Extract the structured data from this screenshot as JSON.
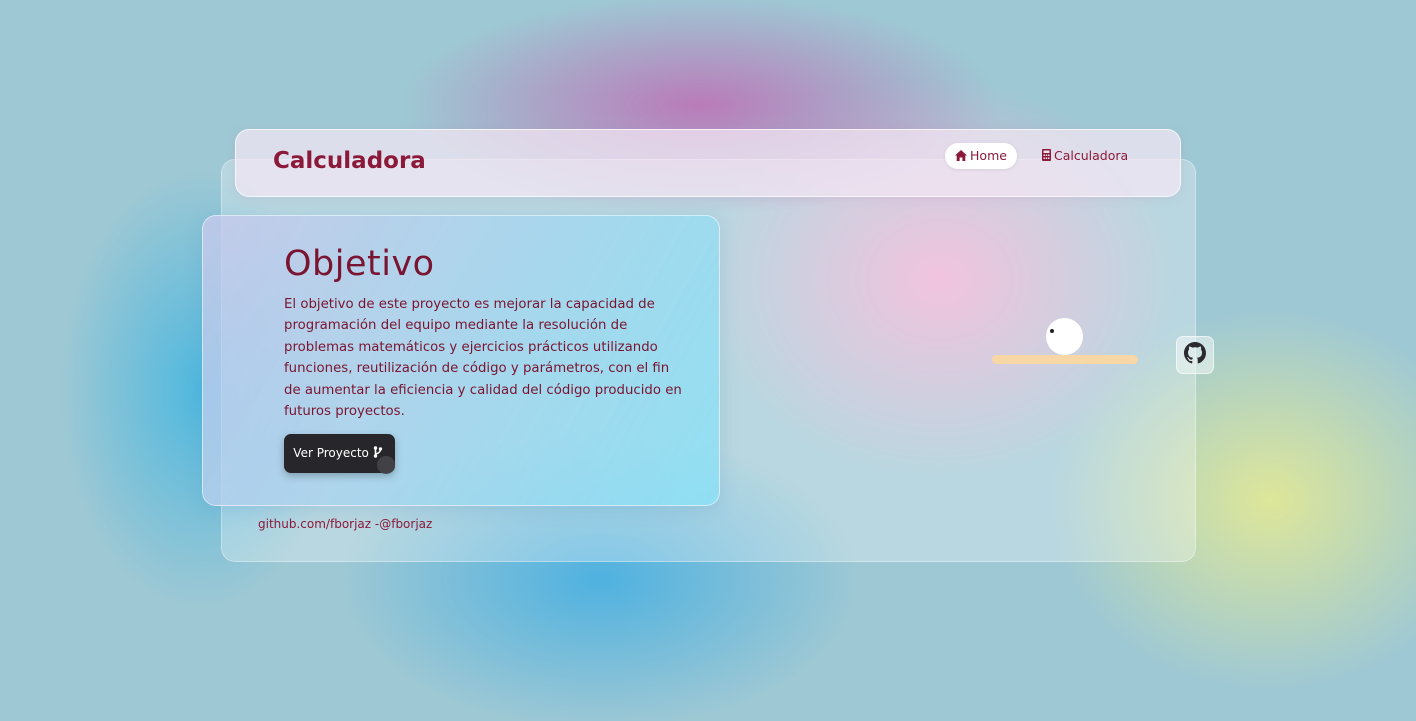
{
  "nav": {
    "brand": "Calculadora",
    "links": [
      {
        "label": "Home",
        "icon": "home-icon",
        "active": true
      },
      {
        "label": "Calculadora",
        "icon": "calculator-icon",
        "active": false
      }
    ]
  },
  "objective": {
    "title": "Objetivo",
    "description": "El objetivo de este proyecto es mejorar la capacidad de programación del equipo mediante la resolución de problemas matemáticos y ejercicios prácticos utilizando funciones, reutilización de código y parámetros, con el fin de aumentar la eficiencia y calidad del código producido en futuros proyectos.",
    "button_label": "Ver Proyecto",
    "button_icon": "git-branch-icon"
  },
  "footer": {
    "text": "github.com/fborjaz -@fborjaz"
  },
  "github_button": {
    "icon": "github-icon"
  },
  "colors": {
    "accent": "#8b1a3a",
    "button_bg": "#26262b",
    "shelf": "#f7d7a6"
  }
}
